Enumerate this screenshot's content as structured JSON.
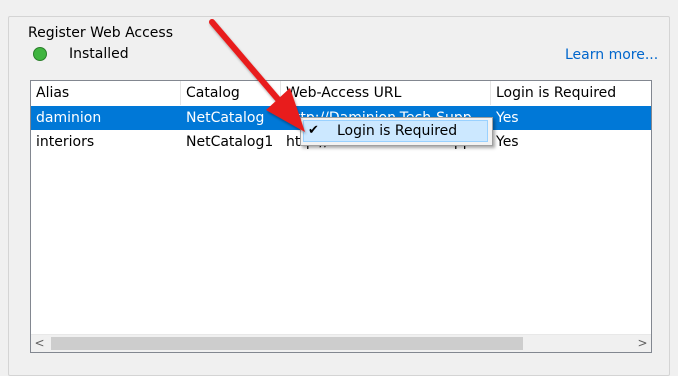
{
  "group": {
    "title": "Register Web Access"
  },
  "status": {
    "label": "Installed",
    "color": "#3fb53f"
  },
  "learn_more": "Learn more...",
  "table": {
    "columns": [
      "Alias",
      "Catalog",
      "Web-Access URL",
      "Login is Required"
    ],
    "rows": [
      {
        "alias": "daminion",
        "catalog": "NetCatalog",
        "url": "http://Daminion-Tech-Supp...",
        "login": "Yes",
        "selected": true
      },
      {
        "alias": "interiors",
        "catalog": "NetCatalog1",
        "url": "http://Daminion-Tech-Supp...",
        "login": "Yes",
        "selected": false
      }
    ]
  },
  "context_menu": {
    "item_label": "Login is Required",
    "checked": true
  },
  "colors": {
    "selection": "#0078d7",
    "link": "#0066cc",
    "annotation_arrow": "#e81b1b"
  }
}
